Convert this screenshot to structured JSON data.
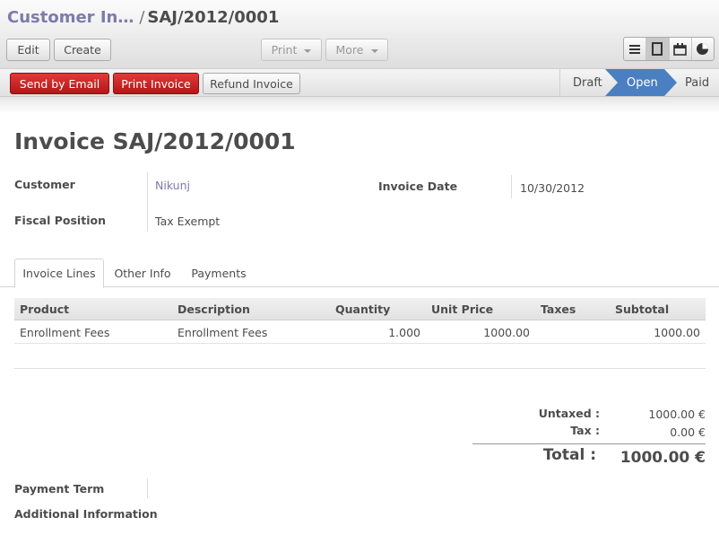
{
  "breadcrumb": {
    "parent": "Customer In…",
    "separator": "/",
    "current": "SAJ/2012/0001"
  },
  "toolbar": {
    "edit": "Edit",
    "create": "Create",
    "print": "Print",
    "more": "More"
  },
  "views": [
    "list-icon",
    "form-icon",
    "calendar-icon",
    "graph-icon"
  ],
  "actions": {
    "send_email": "Send by Email",
    "print_invoice": "Print Invoice",
    "refund": "Refund Invoice"
  },
  "states": {
    "draft": "Draft",
    "open": "Open",
    "paid": "Paid",
    "current": "Open"
  },
  "form": {
    "title": "Invoice SAJ/2012/0001",
    "customer_label": "Customer",
    "customer_value": "Nikunj",
    "fiscal_label": "Fiscal Position",
    "fiscal_value": "Tax Exempt",
    "date_label": "Invoice Date",
    "date_value": "10/30/2012"
  },
  "tabs": [
    {
      "label": "Invoice Lines",
      "active": true
    },
    {
      "label": "Other Info",
      "active": false
    },
    {
      "label": "Payments",
      "active": false
    }
  ],
  "lines": {
    "headers": [
      "Product",
      "Description",
      "Quantity",
      "Unit Price",
      "Taxes",
      "Subtotal"
    ],
    "rows": [
      {
        "product": "Enrollment Fees",
        "description": "Enrollment Fees",
        "quantity": "1.000",
        "unit_price": "1000.00",
        "taxes": "",
        "subtotal": "1000.00"
      }
    ]
  },
  "totals": {
    "untaxed_label": "Untaxed :",
    "untaxed_value": "1000.00 €",
    "tax_label": "Tax :",
    "tax_value": "0.00 €",
    "total_label": "Total :",
    "total_value": "1000.00 €"
  },
  "footer": {
    "payment_term_label": "Payment Term",
    "additional_info_label": "Additional Information"
  },
  "colors": {
    "accent": "#7c7bad",
    "action_red": "#c92424",
    "state_active": "#4a7fc1"
  }
}
